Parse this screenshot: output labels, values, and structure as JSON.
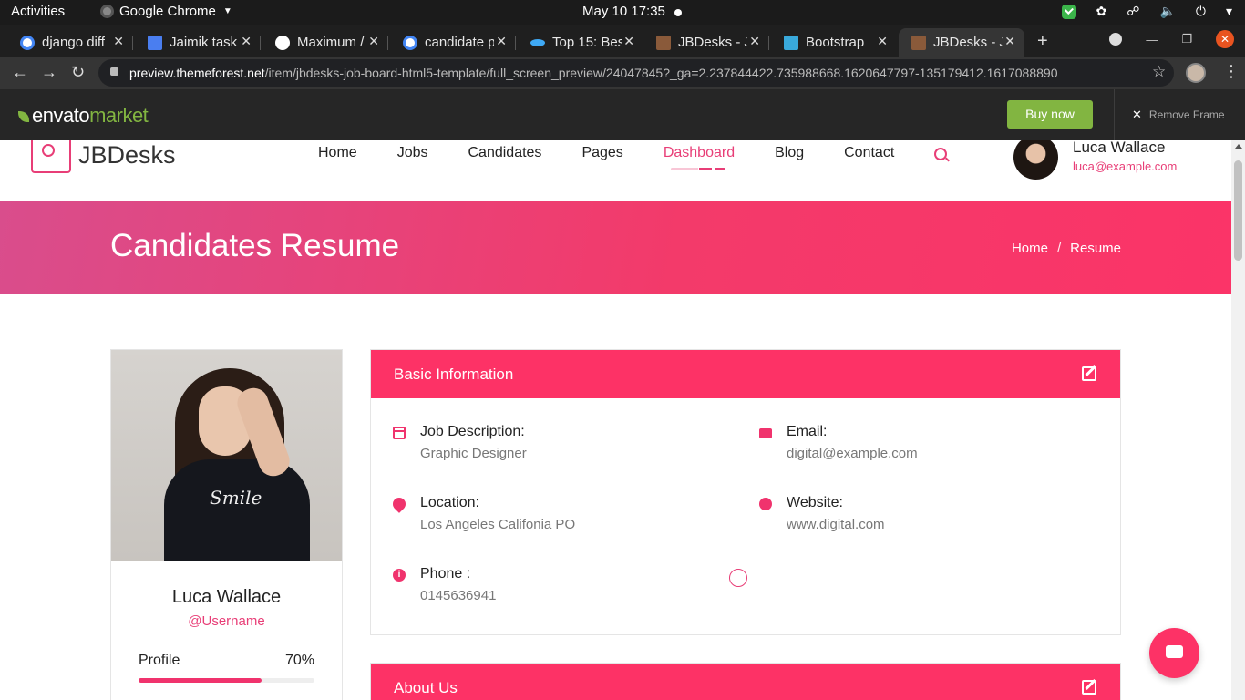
{
  "os": {
    "activities": "Activities",
    "app_name": "Google Chrome",
    "clock": "May 10  17:35"
  },
  "browser": {
    "tabs": [
      {
        "title": "django diff",
        "favicon_color": "#4285f4"
      },
      {
        "title": "Jaimik task",
        "favicon_color": "#4a7ef0"
      },
      {
        "title": "Maximum /",
        "favicon_color": "#ffffff"
      },
      {
        "title": "candidate p",
        "favicon_color": "#4285f4"
      },
      {
        "title": "Top 15: Bes",
        "favicon_color": "#3fa9f5"
      },
      {
        "title": "JBDesks - J",
        "favicon_color": "#8a5a3a"
      },
      {
        "title": "Bootstrap",
        "favicon_color": "#39a9db"
      },
      {
        "title": "JBDesks - J",
        "favicon_color": "#8a5a3a"
      }
    ],
    "active_tab_index": 7,
    "url_host": "preview.themeforest.net",
    "url_path": "/item/jbdesks-job-board-html5-template/full_screen_preview/24047845?_ga=2.237844422.735988668.1620647797-135179412.1617088890"
  },
  "envato": {
    "logo_part1": "envato",
    "logo_part2": "market",
    "buy_label": "Buy now",
    "remove_label": "Remove Frame"
  },
  "site": {
    "brand": "JBDesks",
    "nav": [
      "Home",
      "Jobs",
      "Candidates",
      "Pages",
      "Dashboard",
      "Blog",
      "Contact"
    ],
    "active_nav": "Dashboard",
    "user_name": "Luca Wallace",
    "user_email": "luca@example.com",
    "accent_color": "#fd3266"
  },
  "hero": {
    "title": "Candidates Resume",
    "crumb_home": "Home",
    "crumb_sep": "/",
    "crumb_current": "Resume"
  },
  "profile": {
    "name": "Luca Wallace",
    "username": "@Username",
    "completion_label": "Profile",
    "completion_text": "70%",
    "completion_fraction": 0.7,
    "shirt_text": "Smile"
  },
  "basic_info": {
    "heading": "Basic Information",
    "fields": {
      "job": {
        "label": "Job Description:",
        "value": "Graphic Designer",
        "icon": "calendar-icon"
      },
      "email": {
        "label": "Email:",
        "value": "digital@example.com",
        "icon": "envelope-icon"
      },
      "location": {
        "label": "Location:",
        "value": "Los Angeles Califonia PO",
        "icon": "map-pin-icon"
      },
      "website": {
        "label": "Website:",
        "value": "www.digital.com",
        "icon": "globe-icon"
      },
      "phone": {
        "label": "Phone :",
        "value": "0145636941",
        "icon": "info-icon"
      }
    }
  },
  "about": {
    "heading": "About Us"
  }
}
